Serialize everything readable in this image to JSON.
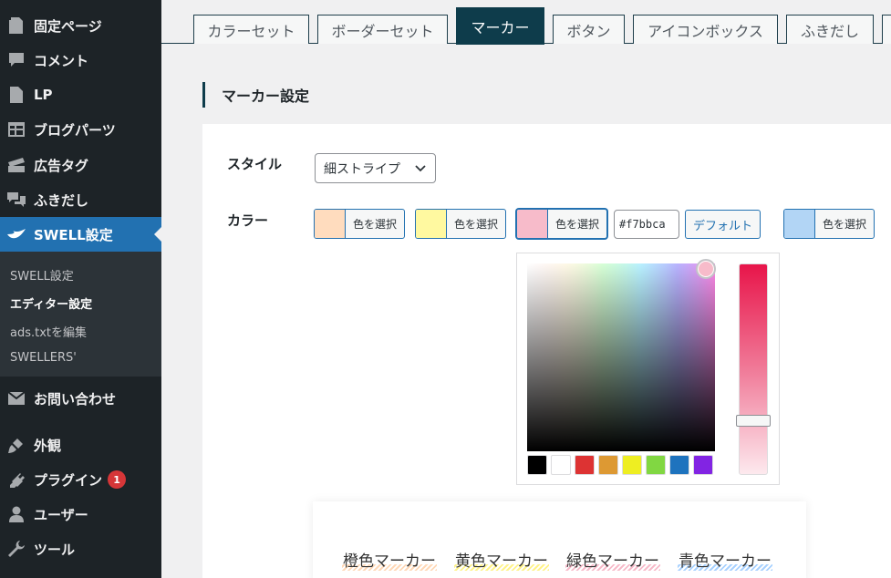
{
  "sidebar": {
    "items": [
      {
        "label": "固定ページ",
        "icon": "page-icon"
      },
      {
        "label": "コメント",
        "icon": "comment-icon"
      },
      {
        "label": "LP",
        "icon": "document-icon"
      },
      {
        "label": "ブログパーツ",
        "icon": "grid-icon"
      },
      {
        "label": "広告タグ",
        "icon": "ticket-icon"
      },
      {
        "label": "ふきだし",
        "icon": "chat-icon"
      },
      {
        "label": "SWELL設定",
        "icon": "swell-bird-icon"
      }
    ],
    "submenu": [
      "SWELL設定",
      "エディター設定",
      "ads.txtを編集",
      "SWELLERS'"
    ],
    "lower_items": [
      {
        "label": "お問い合わせ",
        "icon": "mail-icon"
      },
      {
        "label": "外観",
        "icon": "brush-icon"
      },
      {
        "label": "プラグイン",
        "icon": "plugin-icon",
        "badge": "1"
      },
      {
        "label": "ユーザー",
        "icon": "user-icon"
      },
      {
        "label": "ツール",
        "icon": "wrench-icon"
      }
    ]
  },
  "tabs": [
    "カラーセット",
    "ボーダーセット",
    "マーカー",
    "ボタン",
    "アイコンボックス",
    "ふきだし"
  ],
  "section": {
    "heading": "マーカー設定",
    "style_label": "スタイル",
    "style_value": "細ストライプ",
    "color_label": "カラー",
    "select_color": "色を選択",
    "hex_value": "#f7bbca",
    "default_button": "デフォルト"
  },
  "colors": {
    "orange": "#ffdcbe",
    "yellow": "#fff9a0",
    "pink": "#f7bbca",
    "blue": "#b2d5f5",
    "accent": "#2271b1",
    "tab_active": "#0e3c4b"
  },
  "palette": [
    "#000000",
    "#ffffff",
    "#dd3333",
    "#dd9933",
    "#eeee22",
    "#81d742",
    "#1e73be",
    "#8224e3"
  ],
  "preview": [
    "橙色マーカー",
    "黄色マーカー",
    "緑色マーカー",
    "青色マーカー"
  ]
}
